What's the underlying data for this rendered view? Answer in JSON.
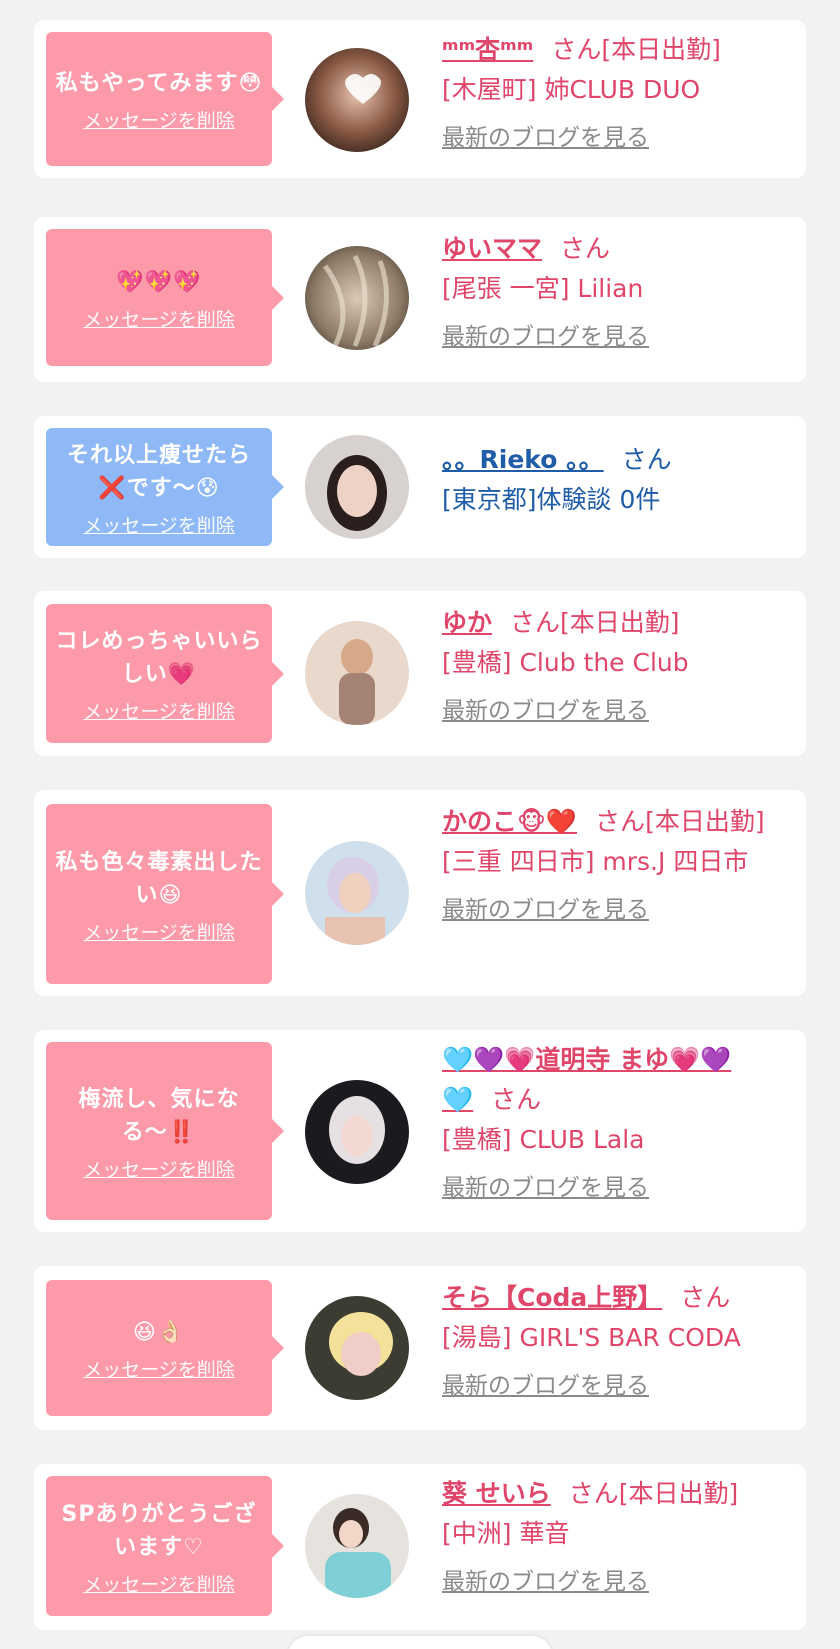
{
  "delete_label": "メッセージを削除",
  "blog_label": "最新のブログを見る",
  "san_label": "さん",
  "colors": {
    "pink_bubble": "#fd9aaa",
    "blue_bubble": "#8fb9f6",
    "pink_text": "#e0456a",
    "blue_text": "#1f5da8",
    "gray_link": "#8a8a8a"
  },
  "cards": [
    {
      "message": "私もやってみます😳",
      "name": "ᵐᵐ杏ᵐᵐ",
      "suffix": "[本日出勤]",
      "shop": "[木屋町] 姉CLUB DUO",
      "has_blog": true,
      "theme": "pink"
    },
    {
      "message": "💖💖💖",
      "name": "ゆいママ",
      "suffix": "",
      "shop": "[尾張 一宮] Lilian",
      "has_blog": true,
      "theme": "pink"
    },
    {
      "message": "それ以上痩せたら❌です〜😰",
      "name": "。。Rieko 。。",
      "suffix": "",
      "shop": "[東京都]体験談 0件",
      "has_blog": false,
      "theme": "blue"
    },
    {
      "message": "コレめっちゃいいらしい💗",
      "name": "ゆか",
      "suffix": "[本日出勤]",
      "shop": "[豊橋] Club the Club",
      "has_blog": true,
      "theme": "pink"
    },
    {
      "message": "私も色々毒素出したい😆",
      "name": "かのこ🐵❤️",
      "suffix": "[本日出勤]",
      "shop": "[三重 四日市] mrs.J 四日市",
      "has_blog": true,
      "theme": "pink"
    },
    {
      "message": "梅流し、気になる〜‼️",
      "name": "🩵💜💗道明寺 まゆ💗💜🩵",
      "suffix": "",
      "shop": "[豊橋] CLUB Lala",
      "has_blog": true,
      "theme": "pink"
    },
    {
      "message": "😆👌🏻",
      "name": "そら【Coda上野】",
      "suffix": "",
      "shop": "[湯島] GIRL'S BAR CODA",
      "has_blog": true,
      "theme": "pink"
    },
    {
      "message": "SPありがとうございます♡",
      "name": "葵 せいら",
      "suffix": "[本日出勤]",
      "shop": "[中洲] 華音",
      "has_blog": true,
      "theme": "pink"
    }
  ]
}
